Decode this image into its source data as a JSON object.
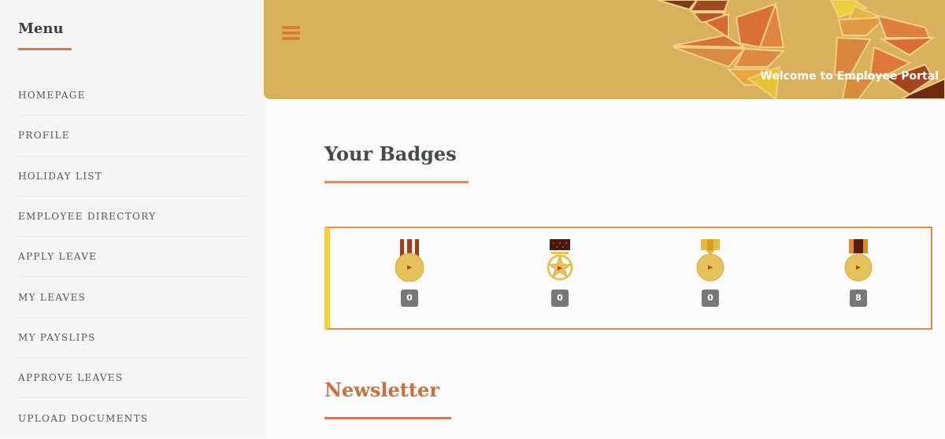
{
  "sidebar": {
    "title": "Menu",
    "items": [
      {
        "label": "HOMEPAGE"
      },
      {
        "label": "PROFILE"
      },
      {
        "label": "HOLIDAY LIST"
      },
      {
        "label": "EMPLOYEE DIRECTORY"
      },
      {
        "label": "APPLY LEAVE"
      },
      {
        "label": "MY LEAVES"
      },
      {
        "label": "MY PAYSLIPS"
      },
      {
        "label": "APPROVE LEAVES"
      },
      {
        "label": "UPLOAD DOCUMENTS"
      }
    ]
  },
  "header": {
    "menu_icon": "hamburger-icon",
    "welcome_text": "Welcome to Employee Portal"
  },
  "badges": {
    "title": "Your Badges",
    "items": [
      {
        "icon": "medal-striped-ribbon-icon",
        "count": "0"
      },
      {
        "icon": "medal-star-icon",
        "count": "0"
      },
      {
        "icon": "medal-gold-ribbon-icon",
        "count": "0"
      },
      {
        "icon": "medal-brown-ribbon-icon",
        "count": "8"
      }
    ]
  },
  "newsletter": {
    "title": "Newsletter"
  },
  "colors": {
    "accent": "#dd8a57",
    "banner": "#d9b05c",
    "highlight": "#f3d23b",
    "count_badge": "#777777"
  }
}
